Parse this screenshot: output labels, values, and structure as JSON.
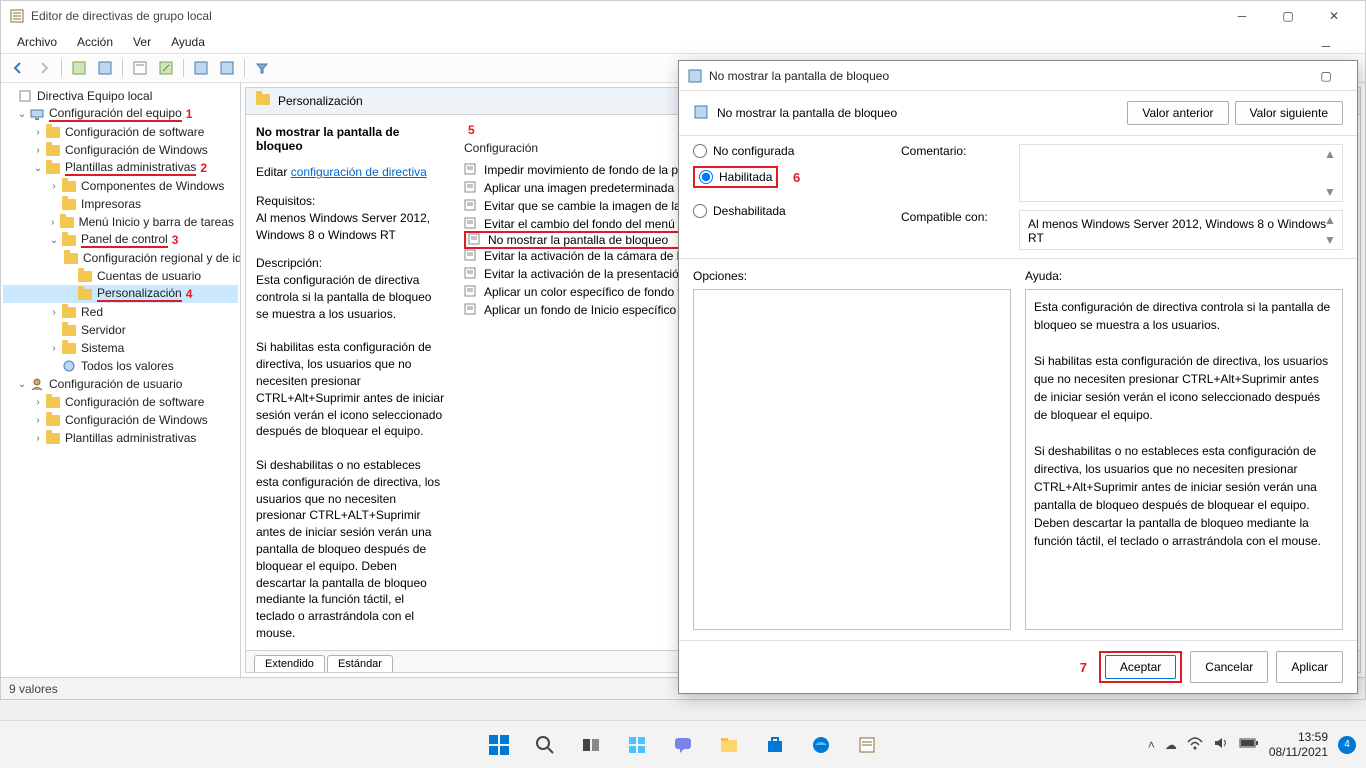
{
  "main_window": {
    "title": "Editor de directivas de grupo local",
    "menus": [
      "Archivo",
      "Acción",
      "Ver",
      "Ayuda"
    ],
    "status_bar": "9 valores",
    "tabs": [
      "Extendido",
      "Estándar"
    ]
  },
  "tree": {
    "root": "Directiva Equipo local",
    "computer_config": "Configuración del equipo",
    "software_config": "Configuración de software",
    "windows_config": "Configuración de Windows",
    "admin_templates": "Plantillas administrativas",
    "windows_components": "Componentes de Windows",
    "printers": "Impresoras",
    "start_menu": "Menú Inicio y barra de tareas",
    "control_panel": "Panel de control",
    "regional_config": "Configuración regional y de idioma",
    "user_accounts": "Cuentas de usuario",
    "personalization": "Personalización",
    "network": "Red",
    "server": "Servidor",
    "system": "Sistema",
    "all_values": "Todos los valores",
    "user_config": "Configuración de usuario",
    "user_software": "Configuración de software",
    "user_windows": "Configuración de Windows",
    "user_admin": "Plantillas administrativas"
  },
  "annotations": {
    "n1": "1",
    "n2": "2",
    "n3": "3",
    "n4": "4",
    "n5": "5",
    "n6": "6",
    "n7": "7"
  },
  "detail": {
    "header": "Personalización",
    "policy_title": "No mostrar la pantalla de bloqueo",
    "edit_label": "Editar",
    "edit_link": "configuración de directiva",
    "requirements_label": "Requisitos:",
    "requirements_text": "Al menos Windows Server 2012, Windows 8 o Windows RT",
    "description_label": "Descripción:",
    "description_text": "Esta configuración de directiva controla si la pantalla de bloqueo se muestra a los usuarios.\n\nSi habilitas esta configuración de directiva, los usuarios que no necesiten presionar CTRL+Alt+Suprimir antes de iniciar sesión verán el icono seleccionado después de bloquear el equipo.\n\nSi deshabilitas o no estableces esta configuración de directiva, los usuarios que no necesiten presionar CTRL+ALT+Suprimir antes de iniciar sesión verán una pantalla de bloqueo después de bloquear el equipo. Deben descartar la pantalla de bloqueo mediante la función táctil, el teclado o arrastrándola con el mouse.",
    "column_header": "Configuración",
    "settings": [
      "Impedir movimiento de fondo de la pantalla",
      "Aplicar una imagen predeterminada de pantalla",
      "Evitar que se cambie la imagen de la pantalla",
      "Evitar el cambio del fondo del menú",
      "No mostrar la pantalla de bloqueo",
      "Evitar la activación de la cámara de la pantalla",
      "Evitar la activación de la presentación",
      "Aplicar un color específico de fondo y",
      "Aplicar un fondo de Inicio específico"
    ]
  },
  "dialog": {
    "title": "No mostrar la pantalla de bloqueo",
    "policy_label": "No mostrar la pantalla de bloqueo",
    "prev_btn": "Valor anterior",
    "next_btn": "Valor siguiente",
    "radio_not_configured": "No configurada",
    "radio_enabled": "Habilitada",
    "radio_disabled": "Deshabilitada",
    "comment_label": "Comentario:",
    "compat_label": "Compatible con:",
    "compat_text": "Al menos Windows Server 2012, Windows 8 o Windows RT",
    "options_label": "Opciones:",
    "help_label": "Ayuda:",
    "help_text": "Esta configuración de directiva controla si la pantalla de bloqueo se muestra a los usuarios.\n\nSi habilitas esta configuración de directiva, los usuarios que no necesiten presionar CTRL+Alt+Suprimir antes de iniciar sesión verán el icono seleccionado después de bloquear el equipo.\n\nSi deshabilitas o no estableces esta configuración de directiva, los usuarios que no necesiten presionar CTRL+Alt+Suprimir antes de iniciar sesión verán una pantalla de bloqueo después de bloquear el equipo. Deben descartar la pantalla de bloqueo mediante la función táctil, el teclado o arrastrándola con el mouse.",
    "ok_btn": "Aceptar",
    "cancel_btn": "Cancelar",
    "apply_btn": "Aplicar"
  },
  "taskbar": {
    "time": "13:59",
    "date": "08/11/2021",
    "notif_count": "4"
  }
}
